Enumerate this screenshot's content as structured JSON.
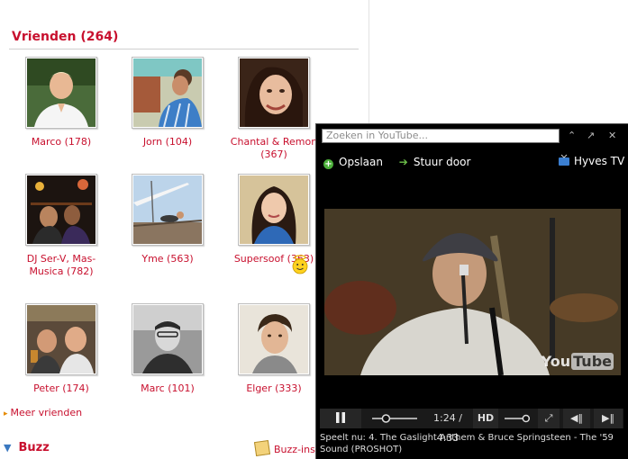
{
  "friends_section": {
    "title": "Vrienden (264)",
    "friends": [
      {
        "name": "Marco (178)"
      },
      {
        "name": "Jorn (104)"
      },
      {
        "name": "Chantal & Remon (367)"
      },
      {
        "name": "DJ Ser-V, Mas-Musica (782)"
      },
      {
        "name": "Yme (563)"
      },
      {
        "name": "Supersoof (363)"
      },
      {
        "name": "Peter (174)"
      },
      {
        "name": "Marc (101)"
      },
      {
        "name": "Elger (333)"
      }
    ],
    "more_link": "Meer vrienden"
  },
  "buzz": {
    "title": "Buzz",
    "settings_link": "Buzz-inst"
  },
  "player": {
    "search_placeholder": "Zoeken in YouTube...",
    "save_label": "Opslaan",
    "forward_label": "Stuur door",
    "channel_label": "Hyves TV",
    "time": "1:24 / 4:33",
    "progress": 0.308,
    "volume": 0.85,
    "hd_label": "HD",
    "watermark": "You",
    "watermark_tube": "Tube",
    "now_playing": "Speelt nu: 4. The Gaslight Anthem & Bruce Springsteen - The '59 Sound (PROSHOT)"
  },
  "colors": {
    "accent_red": "#c8102e",
    "player_bg": "#000000"
  }
}
